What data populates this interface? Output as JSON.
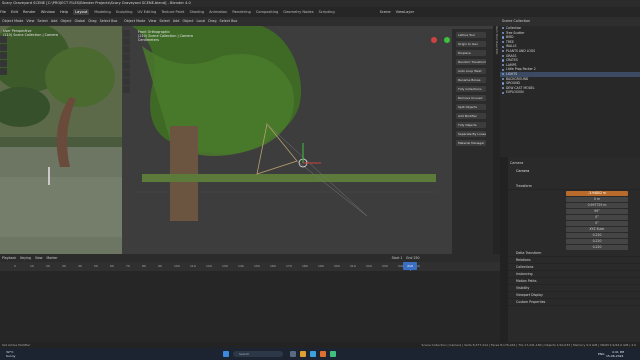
{
  "window": {
    "title": "Scary Graveyard SCENE [C:\\PROJECT FILES\\Blender Projects\\Scary Graveyard SCENE.blend] - Blender 4.0"
  },
  "menu": {
    "items": [
      "File",
      "Edit",
      "Render",
      "Window",
      "Help"
    ],
    "workspaces": [
      "Layout",
      "Modeling",
      "Sculpting",
      "UV Editing",
      "Texture Paint",
      "Shading",
      "Animation",
      "Rendering",
      "Compositing",
      "Geometry Nodes",
      "Scripting"
    ],
    "active_workspace": "Layout",
    "scene": "Scene",
    "view_layer": "ViewLayer"
  },
  "viewport_left": {
    "header": [
      "Object Mode",
      "View",
      "Select",
      "Add",
      "Object",
      "Global",
      "Drag",
      "Select Box"
    ],
    "overlay": [
      "User Perspective",
      "(210) Scene Collection | Camera"
    ]
  },
  "viewport_right": {
    "header": [
      "Object Mode",
      "View",
      "Select",
      "Add",
      "Object",
      "Local",
      "Drag",
      "Select Box"
    ],
    "overlay": [
      "Front Orthographic",
      "(210) Scene Collection | Camera",
      "Centimeters"
    ],
    "gizmo_label": "Displace",
    "npanel": [
      "Lattice Tool",
      "Origin to Geo",
      "Displace",
      "Random Transform",
      "Auto Loop Weld",
      "Rename Bones",
      "Tidy Collections",
      "Remove Unused",
      "Split Objects",
      "Add Modifier",
      "Tidy Objects",
      "Separate By Loose",
      "Material Manager"
    ]
  },
  "timeline": {
    "header": [
      "Playback",
      "Keying",
      "View",
      "Marker"
    ],
    "current_frame": "210",
    "start": "Start 1",
    "end": "End 250",
    "ticks": [
      "0",
      "10",
      "20",
      "30",
      "40",
      "50",
      "60",
      "70",
      "80",
      "90",
      "100",
      "110",
      "120",
      "130",
      "140",
      "150",
      "160",
      "170",
      "180",
      "190",
      "200",
      "210",
      "220",
      "230",
      "240",
      "250"
    ]
  },
  "outliner": {
    "title": "Scene Collection",
    "rows": [
      "Collection",
      "Tree Scatter",
      "BIRD",
      "TREE",
      "WALLS",
      "PLANTS AND LOGS",
      "GRASS",
      "CRATES",
      "LAMPS",
      "Little Prop Packer 2",
      "LIGHTS",
      "BACKGROUND",
      "GROUND",
      "DEW CAST MODEL",
      "EXPLOSION"
    ]
  },
  "properties": {
    "object_name": "Camera",
    "data_name": "Camera",
    "section_transform": "Transform",
    "location": {
      "label": "Location X",
      "x": "-3.94802 m",
      "y": "0 m",
      "z": "0.997729 m"
    },
    "rotation": {
      "label": "Rotation X",
      "x": "90°",
      "y": "0°",
      "z": "0°"
    },
    "mode": {
      "label": "Mode",
      "value": "XYZ Euler"
    },
    "scale": {
      "label": "Scale X",
      "x": "0.220",
      "y": "0.220",
      "z": "0.220"
    },
    "sections": [
      "Delta Transform",
      "Relations",
      "Collections",
      "Instancing",
      "Motion Paths",
      "Visibility",
      "Viewport Display",
      "Custom Properties"
    ]
  },
  "status": {
    "left": "Set Active Modifier",
    "right": "Scene Collection | Camera | Verts 8,377,414 | Faces 8,176,444 | Tris 17,241,180 | Objects 1/10,033 | Memory 9.9 GiB | VRAM 4.9/24.0 GiB | 4.0"
  },
  "taskbar": {
    "weather_temp": "32°C",
    "weather_desc": "Sunny",
    "search_placeholder": "Search",
    "lang": "ENG",
    "time": "4:41 PM",
    "date": "15-06-2024"
  },
  "colors": {
    "accent": "#3b6fc2",
    "orange": "#b86b2a",
    "selection": "#3d4a63"
  }
}
